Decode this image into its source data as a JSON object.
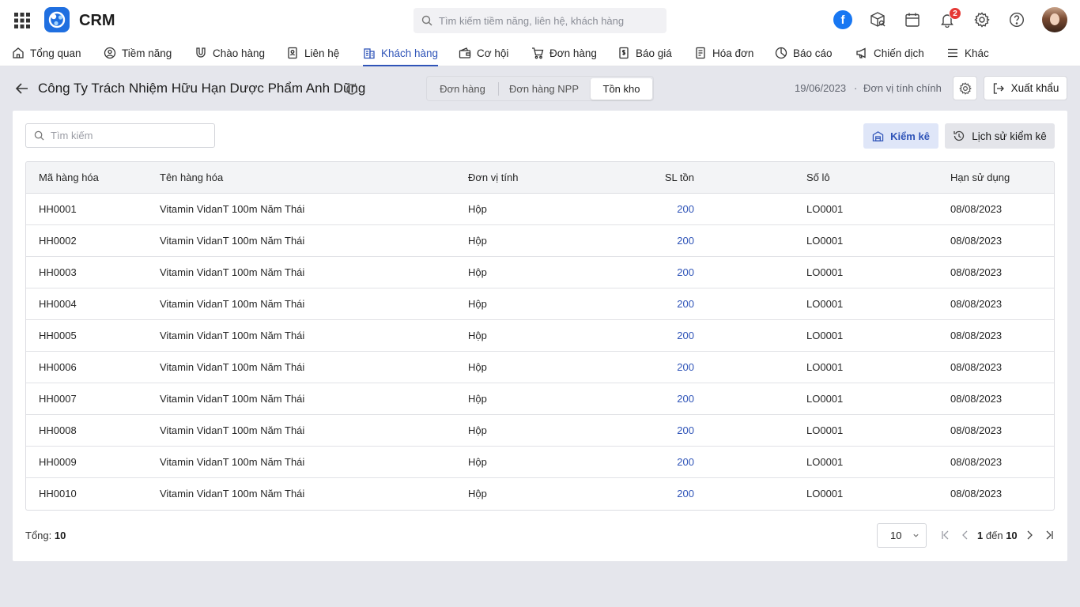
{
  "app": {
    "name": "CRM"
  },
  "topbar": {
    "search_placeholder": "Tìm kiếm tiềm năng, liên hệ, khách hàng",
    "notification_count": "2",
    "facebook_letter": "f"
  },
  "nav": [
    {
      "label": "Tổng quan",
      "icon": "home-icon"
    },
    {
      "label": "Tiềm năng",
      "icon": "person-circle-icon"
    },
    {
      "label": "Chào hàng",
      "icon": "magnet-icon"
    },
    {
      "label": "Liên hệ",
      "icon": "contact-card-icon"
    },
    {
      "label": "Khách hàng",
      "icon": "building-icon",
      "active": true
    },
    {
      "label": "Cơ hội",
      "icon": "wallet-icon"
    },
    {
      "label": "Đơn hàng",
      "icon": "cart-icon"
    },
    {
      "label": "Báo giá",
      "icon": "dollar-doc-icon"
    },
    {
      "label": "Hóa đơn",
      "icon": "invoice-icon"
    },
    {
      "label": "Báo cáo",
      "icon": "pie-chart-icon"
    },
    {
      "label": "Chiến dịch",
      "icon": "megaphone-icon"
    },
    {
      "label": "Khác",
      "icon": "menu-icon"
    }
  ],
  "header": {
    "company": "Công Ty Trách Nhiệm Hữu Hạn Dược Phẩm Anh Dũng",
    "tabs": [
      "Đơn hàng",
      "Đơn hàng NPP",
      "Tồn kho"
    ],
    "active_tab": "Tồn kho",
    "date": "19/06/2023",
    "separator": "·",
    "unit": "Đơn vị tính chính",
    "export_label": "Xuất khẩu"
  },
  "toolbar": {
    "search_placeholder": "Tìm kiếm",
    "kiemke_label": "Kiểm kê",
    "history_label": "Lịch sử kiểm kê"
  },
  "table": {
    "columns": [
      "Mã hàng hóa",
      "Tên hàng hóa",
      "Đơn vị tính",
      "SL tồn",
      "Số lô",
      "Hạn sử dụng"
    ],
    "rows": [
      [
        "HH0001",
        "Vitamin VidanT 100m Năm Thái",
        "Hộp",
        "200",
        "LO0001",
        "08/08/2023"
      ],
      [
        "HH0002",
        "Vitamin VidanT 100m Năm Thái",
        "Hộp",
        "200",
        "LO0001",
        "08/08/2023"
      ],
      [
        "HH0003",
        "Vitamin VidanT 100m Năm Thái",
        "Hộp",
        "200",
        "LO0001",
        "08/08/2023"
      ],
      [
        "HH0004",
        "Vitamin VidanT 100m Năm Thái",
        "Hộp",
        "200",
        "LO0001",
        "08/08/2023"
      ],
      [
        "HH0005",
        "Vitamin VidanT 100m Năm Thái",
        "Hộp",
        "200",
        "LO0001",
        "08/08/2023"
      ],
      [
        "HH0006",
        "Vitamin VidanT 100m Năm Thái",
        "Hộp",
        "200",
        "LO0001",
        "08/08/2023"
      ],
      [
        "HH0007",
        "Vitamin VidanT 100m Năm Thái",
        "Hộp",
        "200",
        "LO0001",
        "08/08/2023"
      ],
      [
        "HH0008",
        "Vitamin VidanT 100m Năm Thái",
        "Hộp",
        "200",
        "LO0001",
        "08/08/2023"
      ],
      [
        "HH0009",
        "Vitamin VidanT 100m Năm Thái",
        "Hộp",
        "200",
        "LO0001",
        "08/08/2023"
      ],
      [
        "HH0010",
        "Vitamin VidanT 100m Năm Thái",
        "Hộp",
        "200",
        "LO0001",
        "08/08/2023"
      ]
    ]
  },
  "footer": {
    "total_label": "Tổng:",
    "total_value": "10",
    "page_size": "10",
    "range_from": "1",
    "range_sep": "đến",
    "range_to": "10"
  },
  "colors": {
    "accent": "#2f54b8",
    "badge": "#e53935",
    "brand_logo": "#1f6fe0",
    "facebook": "#1877f2"
  }
}
